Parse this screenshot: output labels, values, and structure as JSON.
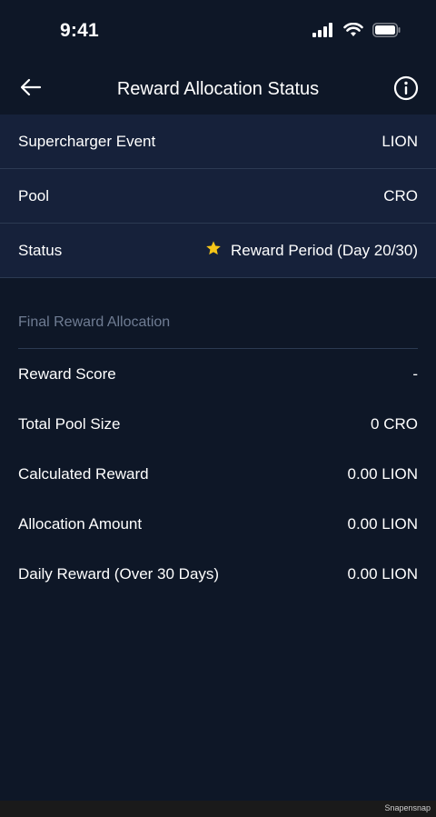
{
  "status_bar": {
    "time": "9:41"
  },
  "nav": {
    "title": "Reward Allocation Status",
    "back_icon": "arrow-left-icon",
    "info_icon": "info-circle-icon"
  },
  "summary": {
    "rows": [
      {
        "label": "Supercharger Event",
        "value": "LION"
      },
      {
        "label": "Pool",
        "value": "CRO"
      },
      {
        "label": "Status",
        "value": "Reward Period (Day 20/30)",
        "icon": "star-icon",
        "icon_color": "#f5c518"
      }
    ]
  },
  "final_allocation": {
    "title": "Final Reward Allocation",
    "rows": [
      {
        "label": "Reward Score",
        "value": "-"
      },
      {
        "label": "Total Pool Size",
        "value": "0 CRO"
      },
      {
        "label": "Calculated Reward",
        "value": "0.00 LION"
      },
      {
        "label": "Allocation Amount",
        "value": "0.00 LION"
      },
      {
        "label": "Daily Reward (Over 30 Days)",
        "value": "0.00 LION"
      }
    ]
  },
  "footer": {
    "watermark": "Snapensnap"
  },
  "colors": {
    "background": "#0e1727",
    "card": "#16213a",
    "divider": "#2c3a52",
    "muted_text": "#6f7c93",
    "star": "#f5c518"
  }
}
